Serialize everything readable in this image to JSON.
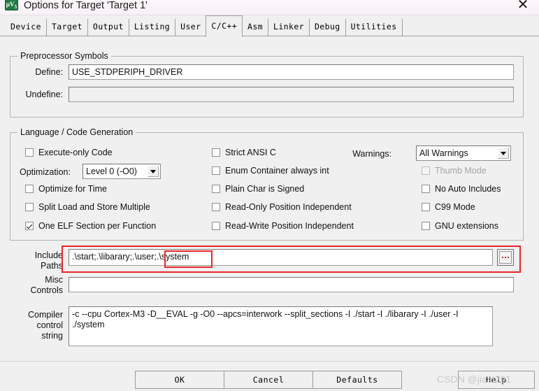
{
  "window": {
    "title": "Options for Target 'Target 1'",
    "icon": "uvision-icon",
    "close_label": "✕"
  },
  "tabs": [
    {
      "label": "Device",
      "active": false
    },
    {
      "label": "Target",
      "active": false
    },
    {
      "label": "Output",
      "active": false
    },
    {
      "label": "Listing",
      "active": false
    },
    {
      "label": "User",
      "active": false
    },
    {
      "label": "C/C++",
      "active": true
    },
    {
      "label": "Asm",
      "active": false
    },
    {
      "label": "Linker",
      "active": false
    },
    {
      "label": "Debug",
      "active": false
    },
    {
      "label": "Utilities",
      "active": false
    }
  ],
  "preprocessor": {
    "group_title": "Preprocessor Symbols",
    "define_label": "Define:",
    "define_value": "USE_STDPERIPH_DRIVER",
    "undefine_label": "Undefine:",
    "undefine_value": ""
  },
  "language": {
    "group_title": "Language / Code Generation",
    "left_checks": [
      {
        "label": "Execute-only Code",
        "checked": false,
        "disabled": false
      },
      {
        "label": "Optimize for Time",
        "checked": false,
        "disabled": false
      },
      {
        "label": "Split Load and Store Multiple",
        "checked": false,
        "disabled": false
      },
      {
        "label": "One ELF Section per Function",
        "checked": true,
        "disabled": false
      }
    ],
    "optimization_label": "Optimization:",
    "optimization_value": "Level 0 (-O0)",
    "middle_checks": [
      {
        "label": "Strict ANSI C",
        "checked": false,
        "disabled": false
      },
      {
        "label": "Enum Container always int",
        "checked": false,
        "disabled": false
      },
      {
        "label": "Plain Char is Signed",
        "checked": false,
        "disabled": false
      },
      {
        "label": "Read-Only Position Independent",
        "checked": false,
        "disabled": false
      },
      {
        "label": "Read-Write Position Independent",
        "checked": false,
        "disabled": false
      }
    ],
    "warnings_label": "Warnings:",
    "warnings_value": "All Warnings",
    "right_checks": [
      {
        "label": "Thumb Mode",
        "checked": false,
        "disabled": true
      },
      {
        "label": "No Auto Includes",
        "checked": false,
        "disabled": false
      },
      {
        "label": "C99 Mode",
        "checked": false,
        "disabled": false
      },
      {
        "label": "GNU extensions",
        "checked": false,
        "disabled": false
      }
    ]
  },
  "paths": {
    "include_label_line1": "Include",
    "include_label_line2": "Paths",
    "include_value": ".\\start;.\\libarary;.\\user;.\\system",
    "browse_label": "...",
    "misc_label_line1": "Misc",
    "misc_label_line2": "Controls",
    "misc_value": ""
  },
  "compiler": {
    "label_line1": "Compiler",
    "label_line2": "control",
    "label_line3": "string",
    "value": "-c --cpu Cortex-M3 -D__EVAL -g -O0 --apcs=interwork --split_sections -I ./start -I ./libarary -I ./user -I\n./system"
  },
  "buttons": {
    "ok": "OK",
    "cancel": "Cancel",
    "defaults": "Defaults",
    "help": "Help"
  },
  "annotations": {
    "include_row_highlight": true,
    "system_token_highlight": true,
    "color": "#e8262b"
  },
  "watermark": "CSDN @jiast291"
}
